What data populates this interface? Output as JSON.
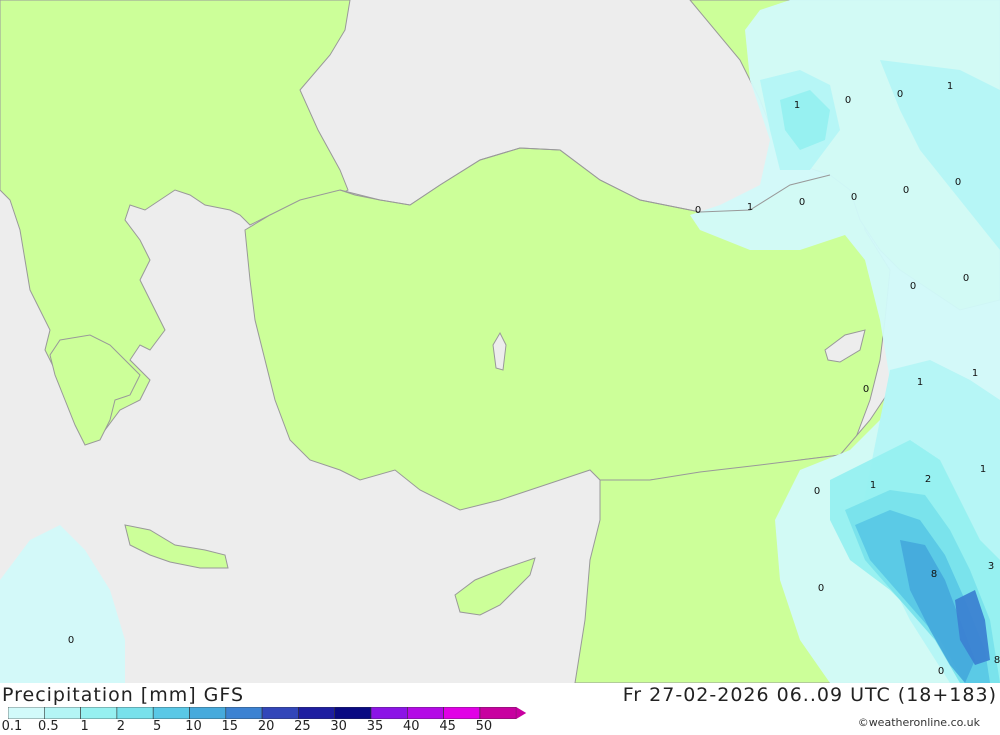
{
  "header": {
    "title": "Precipitation [mm] GFS",
    "valid_time": "Fr 27-02-2026 06..09 UTC (18+183)"
  },
  "legend": {
    "labels": [
      "0.1",
      "0.5",
      "1",
      "2",
      "5",
      "10",
      "15",
      "20",
      "25",
      "30",
      "35",
      "40",
      "45",
      "50"
    ],
    "colors": [
      "#d2fafa",
      "#b4f5f5",
      "#96f0f0",
      "#78e1eb",
      "#5ac8e6",
      "#46aadc",
      "#3c82d2",
      "#3246b9",
      "#1e1ea0",
      "#0a0a82",
      "#8c14e6",
      "#b40ae6",
      "#e100e6",
      "#c800a0"
    ]
  },
  "map_colors": {
    "land": "#ccff99",
    "sea": "#ededed",
    "border": "#999999"
  },
  "contour_values": [
    {
      "name": "val-1",
      "text": "1"
    },
    {
      "name": "val-2",
      "text": "0"
    },
    {
      "name": "val-3",
      "text": "0"
    },
    {
      "name": "val-4",
      "text": "1"
    },
    {
      "name": "val-5",
      "text": "0"
    },
    {
      "name": "val-6",
      "text": "1"
    },
    {
      "name": "val-7",
      "text": "0"
    },
    {
      "name": "val-8",
      "text": "0"
    },
    {
      "name": "val-9",
      "text": "0"
    },
    {
      "name": "val-10",
      "text": "0"
    },
    {
      "name": "val-11",
      "text": "0"
    },
    {
      "name": "val-12",
      "text": "0"
    },
    {
      "name": "val-13",
      "text": "0"
    },
    {
      "name": "val-14",
      "text": "1"
    },
    {
      "name": "val-15",
      "text": "1"
    },
    {
      "name": "val-16",
      "text": "0"
    },
    {
      "name": "val-17",
      "text": "1"
    },
    {
      "name": "val-18",
      "text": "2"
    },
    {
      "name": "val-19",
      "text": "1"
    },
    {
      "name": "val-20",
      "text": "0"
    },
    {
      "name": "val-21",
      "text": "8"
    },
    {
      "name": "val-22",
      "text": "3"
    },
    {
      "name": "val-23",
      "text": "0"
    },
    {
      "name": "val-24",
      "text": "8"
    },
    {
      "name": "val-25",
      "text": "0"
    }
  ],
  "credit": "©weatheronline.co.uk"
}
